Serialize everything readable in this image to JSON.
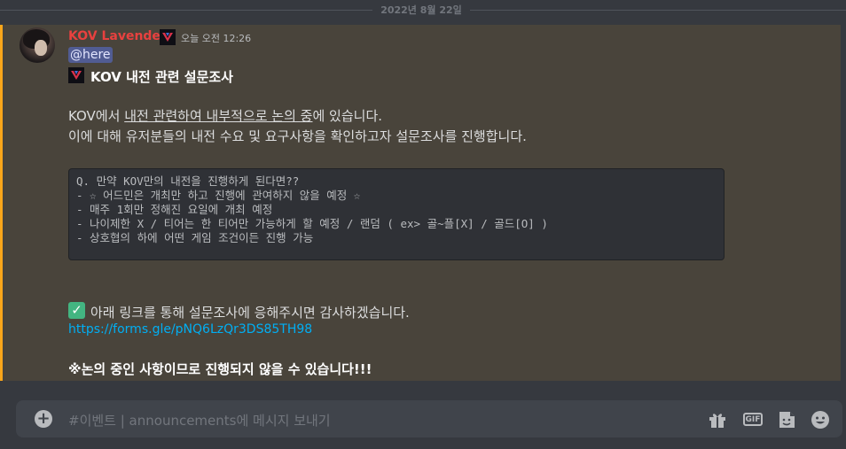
{
  "date_divider": "2022년 8월 22일",
  "message": {
    "author": "KOV Lavender",
    "timestamp": "오늘 오전 12:26",
    "mention": "@here",
    "title": "KOV 내전 관련 설문조사",
    "line1_pre": "KOV에서 ",
    "line1_underlined": "내전 관련하여 내부적으로 논의 중",
    "line1_post": "에 있습니다.",
    "line2": "이에 대해 유저분들의 내전 수요 및 요구사항을 확인하고자 설문조사를 진행합니다.",
    "code_lines": [
      "Q. 만약 KOV만의 내전을 진행하게 된다면??",
      "- ☆ 어드민은 개최만 하고 진행에 관여하지 않을 예정 ☆",
      "- 매주 1회만 정해진 요일에 개최 예정",
      "- 나이제한 X / 티어는 한 티어만 가능하게 할 예정 / 랜덤 ( ex> 골~플[X] / 골드[O] )",
      "- 상호협의 하에 어떤 게임 조건이든 진행 가능"
    ],
    "cta": "아래 링크를 통해 설문조사에 응해주시면 감사하겠습니다.",
    "link": "https://forms.gle/pNQ6LzQr3DS85TH98",
    "warning": "※논의 중인 사항이므로 진행되지 않을 수 있습니다!!!"
  },
  "composer": {
    "placeholder": "#이벤트 | announcements에 메시지 보내기",
    "gif_label": "GIF"
  },
  "colors": {
    "mention_highlight": "#49443b",
    "mention_bar": "#faa61a",
    "author": "#e8413f",
    "link": "#00aff4"
  },
  "icons": [
    "kov-role-icon",
    "check-mark-icon",
    "plus-icon",
    "gift-icon",
    "gif-icon",
    "sticker-icon",
    "emoji-icon"
  ]
}
